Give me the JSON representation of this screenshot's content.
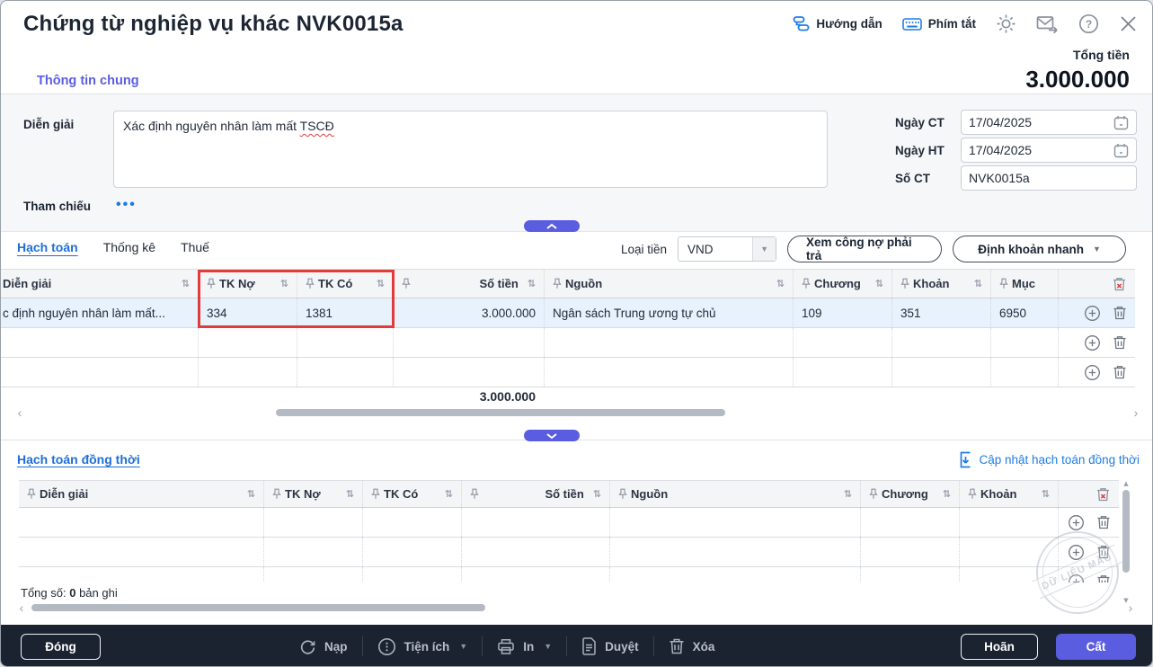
{
  "header": {
    "title": "Chứng từ nghiệp vụ khác NVK0015a",
    "guide_label": "Hướng dẫn",
    "shortcuts_label": "Phím tắt",
    "total_label": "Tổng tiền",
    "total_value": "3.000.000",
    "tab_general": "Thông tin chung"
  },
  "form": {
    "description": {
      "label": "Diễn giải",
      "text": "Xác định nguyên nhân làm mất ",
      "flagged": "TSCĐ"
    },
    "reference": {
      "label": "Tham chiếu",
      "dots": "•••"
    },
    "ngay_ct": {
      "label": "Ngày CT",
      "value": "17/04/2025"
    },
    "ngay_ht": {
      "label": "Ngày HT",
      "value": "17/04/2025"
    },
    "so_ct": {
      "label": "Số CT",
      "value": "NVK0015a"
    }
  },
  "accounting": {
    "tabs": [
      "Hạch toán",
      "Thống kê",
      "Thuế"
    ],
    "currency": {
      "label": "Loại tiền",
      "value": "VND"
    },
    "payables_button": "Xem công nợ phải trả",
    "quick_entry_button": "Định khoản nhanh",
    "table": {
      "columns": [
        "Diễn giải",
        "TK Nợ",
        "TK Có",
        "Số tiền",
        "Nguồn",
        "Chương",
        "Khoản",
        "Mục"
      ],
      "row": {
        "dien_giai": "c định nguyên nhân làm mất...",
        "tk_no": "334",
        "tk_co": "1381",
        "so_tien": "3.000.000",
        "nguon": "Ngân sách Trung ương tự chủ",
        "chuong": "109",
        "khoan": "351",
        "muc": "6950"
      },
      "total": "3.000.000"
    }
  },
  "simultaneous": {
    "title": "Hạch toán đồng thời",
    "update_label": "Cập nhật hạch toán đồng thời",
    "columns": [
      "Diễn giải",
      "TK Nợ",
      "TK Có",
      "Số tiền",
      "Nguồn",
      "Chương",
      "Khoản"
    ],
    "footer": {
      "label": "Tổng số:",
      "count": "0",
      "suffix": "bản ghi"
    }
  },
  "watermark": {
    "text": "DỮ LIỆU MẪU"
  },
  "toolbar": {
    "close": "Đóng",
    "load": "Nạp",
    "utilities": "Tiện ích",
    "print": "In",
    "approve": "Duyệt",
    "delete": "Xóa",
    "postpone": "Hoãn",
    "save": "Cất"
  },
  "colors": {
    "accent_purple": "#5a5de0",
    "link_blue": "#1f7ce5",
    "highlight_red": "#e23b3b",
    "toolbar_dark": "#1b2331",
    "selected_row": "#e7f2fc"
  }
}
